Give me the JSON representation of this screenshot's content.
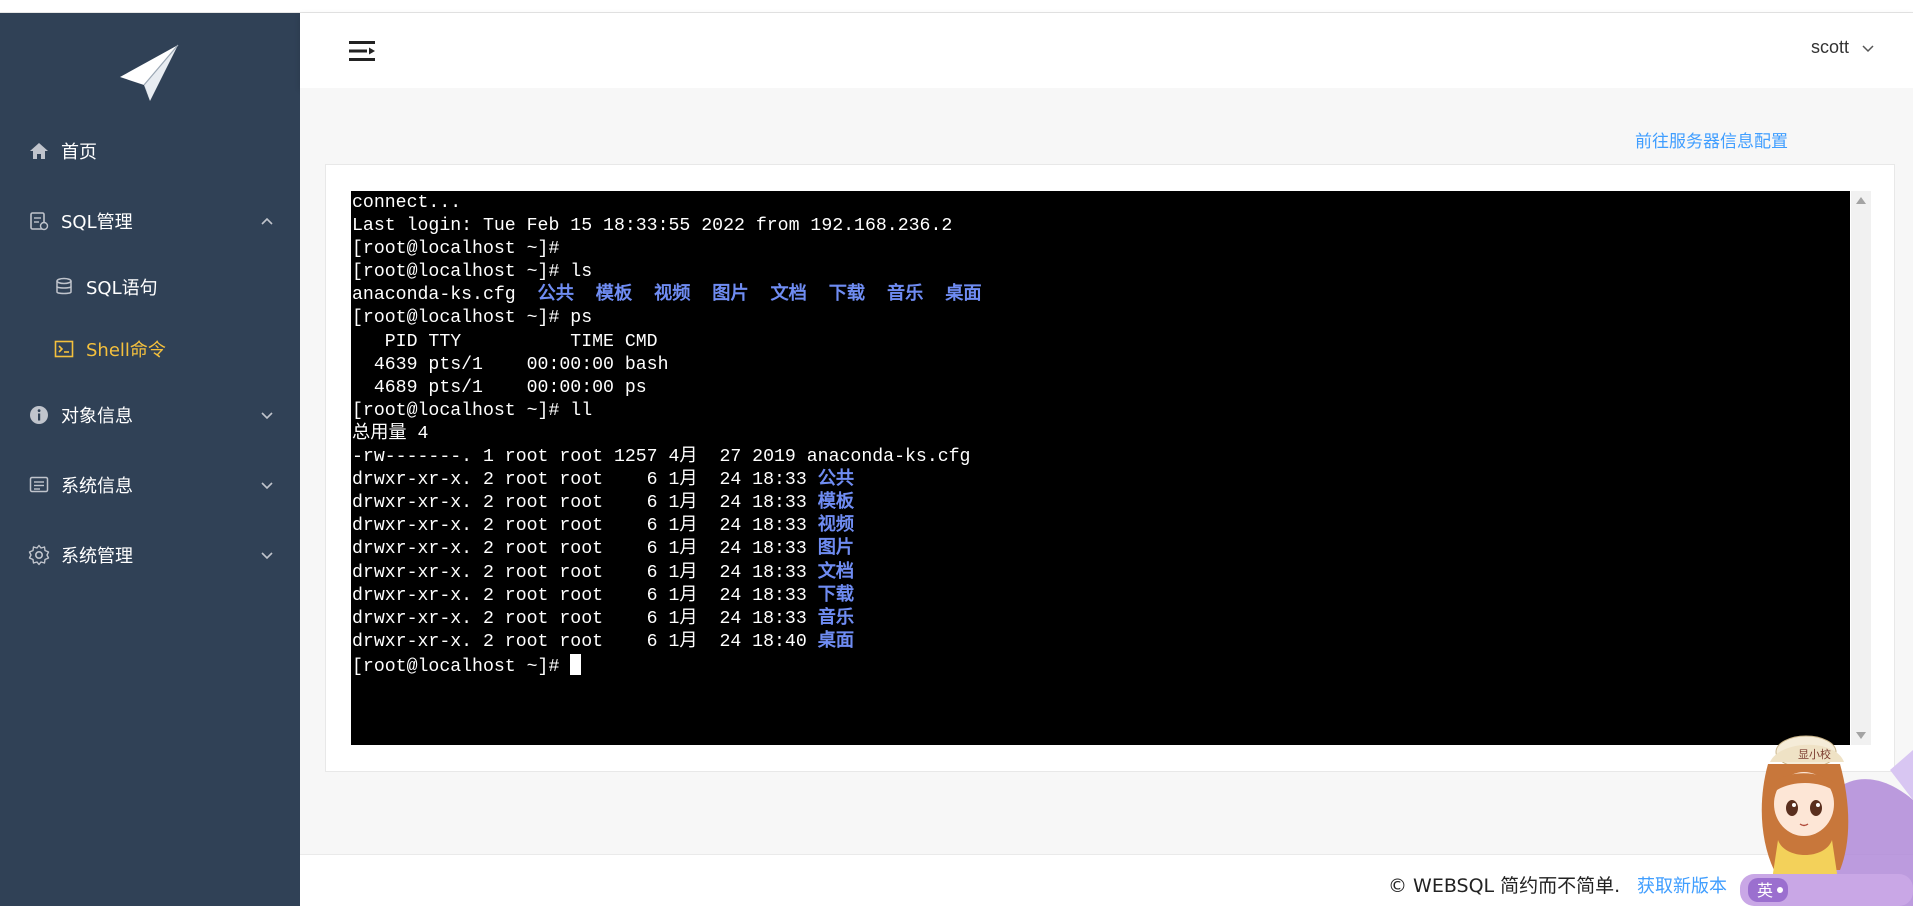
{
  "sidebar": {
    "items": [
      {
        "label": "首页",
        "icon": "home-icon"
      },
      {
        "label": "SQL管理",
        "icon": "sql-icon",
        "expanded": true
      },
      {
        "label": "SQL语句",
        "icon": "database-icon"
      },
      {
        "label": "Shell命令",
        "icon": "terminal-icon",
        "active": true
      },
      {
        "label": "对象信息",
        "icon": "info-icon"
      },
      {
        "label": "系统信息",
        "icon": "list-icon"
      },
      {
        "label": "系统管理",
        "icon": "gear-icon"
      }
    ]
  },
  "header": {
    "user": "scott"
  },
  "main": {
    "server_link": "前往服务器信息配置"
  },
  "terminal": {
    "lines": [
      [
        {
          "t": "connect..."
        }
      ],
      [
        {
          "t": "Last login: Tue Feb 15 18:33:55 2022 from 192.168.236.2"
        }
      ],
      [
        {
          "t": "[root@localhost ~]#"
        }
      ],
      [
        {
          "t": "[root@localhost ~]# ls"
        }
      ],
      [
        {
          "t": "anaconda-ks.cfg  "
        },
        {
          "t": "公共",
          "c": "blue"
        },
        {
          "t": "  "
        },
        {
          "t": "模板",
          "c": "blue"
        },
        {
          "t": "  "
        },
        {
          "t": "视频",
          "c": "blue"
        },
        {
          "t": "  "
        },
        {
          "t": "图片",
          "c": "blue"
        },
        {
          "t": "  "
        },
        {
          "t": "文档",
          "c": "blue"
        },
        {
          "t": "  "
        },
        {
          "t": "下载",
          "c": "blue"
        },
        {
          "t": "  "
        },
        {
          "t": "音乐",
          "c": "blue"
        },
        {
          "t": "  "
        },
        {
          "t": "桌面",
          "c": "blue"
        }
      ],
      [
        {
          "t": "[root@localhost ~]# ps"
        }
      ],
      [
        {
          "t": "   PID TTY          TIME CMD"
        }
      ],
      [
        {
          "t": "  4639 pts/1    00:00:00 bash"
        }
      ],
      [
        {
          "t": "  4689 pts/1    00:00:00 ps"
        }
      ],
      [
        {
          "t": "[root@localhost ~]# ll"
        }
      ],
      [
        {
          "t": "总用量 4"
        }
      ],
      [
        {
          "t": "-rw-------. 1 root root 1257 4月  27 2019 anaconda-ks.cfg"
        }
      ],
      [
        {
          "t": "drwxr-xr-x. 2 root root    6 1月  24 18:33 "
        },
        {
          "t": "公共",
          "c": "blue"
        }
      ],
      [
        {
          "t": "drwxr-xr-x. 2 root root    6 1月  24 18:33 "
        },
        {
          "t": "模板",
          "c": "blue"
        }
      ],
      [
        {
          "t": "drwxr-xr-x. 2 root root    6 1月  24 18:33 "
        },
        {
          "t": "视频",
          "c": "blue"
        }
      ],
      [
        {
          "t": "drwxr-xr-x. 2 root root    6 1月  24 18:33 "
        },
        {
          "t": "图片",
          "c": "blue"
        }
      ],
      [
        {
          "t": "drwxr-xr-x. 2 root root    6 1月  24 18:33 "
        },
        {
          "t": "文档",
          "c": "blue"
        }
      ],
      [
        {
          "t": "drwxr-xr-x. 2 root root    6 1月  24 18:33 "
        },
        {
          "t": "下载",
          "c": "blue"
        }
      ],
      [
        {
          "t": "drwxr-xr-x. 2 root root    6 1月  24 18:33 "
        },
        {
          "t": "音乐",
          "c": "blue"
        }
      ],
      [
        {
          "t": "drwxr-xr-x. 2 root root    6 1月  24 18:40 "
        },
        {
          "t": "桌面",
          "c": "blue"
        }
      ]
    ],
    "prompt": "[root@localhost ~]# "
  },
  "footer": {
    "text": "© WEBSQL 简约而不简单.",
    "link": "获取新版本"
  },
  "mascot": {
    "hat_text": "显小校",
    "badge_text": "英"
  },
  "colors": {
    "sidebar_bg": "#304156",
    "active": "#f4c03d",
    "link": "#409eff",
    "terminal_bg": "#000000",
    "terminal_dir": "#6f8cf2"
  }
}
